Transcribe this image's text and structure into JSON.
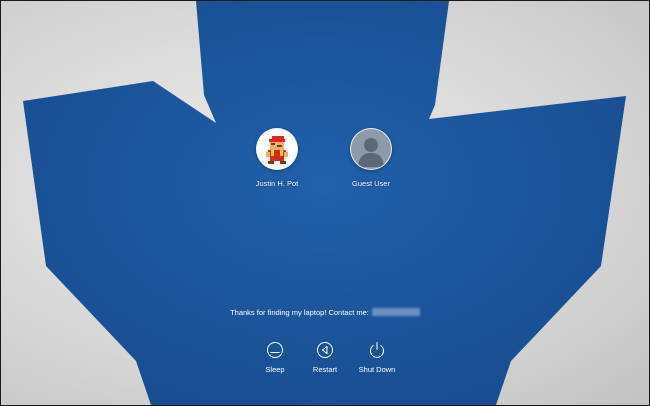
{
  "colors": {
    "wallpaper_blue": "#1b57a0",
    "wallpaper_gray": "#d6d6d6",
    "text": "#ffffff"
  },
  "users": [
    {
      "name": "Justin H. Pot",
      "avatar_icon": "pixel-mario-avatar-icon"
    },
    {
      "name": "Guest User",
      "avatar_icon": "guest-person-icon"
    }
  ],
  "lock_message": {
    "text": "Thanks for finding my laptop! Contact me:"
  },
  "actions": [
    {
      "label": "Sleep",
      "icon": "sleep-icon"
    },
    {
      "label": "Restart",
      "icon": "restart-icon"
    },
    {
      "label": "Shut Down",
      "icon": "power-icon"
    }
  ]
}
